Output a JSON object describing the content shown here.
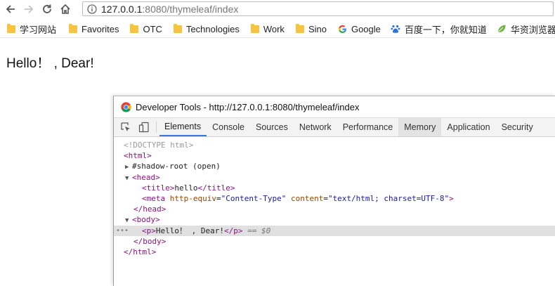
{
  "browser": {
    "url_host": "127.0.0.1",
    "url_path": ":8080/thymeleaf/index",
    "bookmarks": [
      {
        "label": "学习网站",
        "icon": "folder-icon"
      },
      {
        "label": "Favorites",
        "icon": "folder-icon"
      },
      {
        "label": "OTC",
        "icon": "folder-icon"
      },
      {
        "label": "Technologies",
        "icon": "folder-icon"
      },
      {
        "label": "Work",
        "icon": "folder-icon"
      },
      {
        "label": "Sino",
        "icon": "folder-icon"
      },
      {
        "label": "Google",
        "icon": "google-icon"
      },
      {
        "label": "百度一下，你就知道",
        "icon": "baidu-paw-icon"
      },
      {
        "label": "华资浏览器",
        "icon": "leaf-icon"
      }
    ]
  },
  "page": {
    "text": "Hello！ , Dear!"
  },
  "devtools": {
    "title": "Developer Tools - http://127.0.0.1:8080/thymeleaf/index",
    "tabs": [
      "Elements",
      "Console",
      "Sources",
      "Network",
      "Performance",
      "Memory",
      "Application",
      "Security"
    ],
    "selected_tab": "Elements",
    "dom": {
      "doctype": "<!DOCTYPE html>",
      "html_open": "<html>",
      "shadow_root": "#shadow-root (open)",
      "head_open": "<head>",
      "title_open": "<title>",
      "title_text": "hello",
      "title_close": "</title>",
      "meta_open": "<meta ",
      "meta_attr1": "http-equiv",
      "meta_val1": "\"Content-Type\"",
      "meta_attr2": "content",
      "meta_val2": "\"text/html; charset=UTF-8\"",
      "meta_close": ">",
      "head_close": "</head>",
      "body_open": "<body>",
      "p_open": "<p>",
      "p_text": "Hello！ , Dear!",
      "p_close": "</p>",
      "eq0": " == $0",
      "body_close": "</body>",
      "html_close": "</html>",
      "gutter": "•••"
    }
  },
  "colors": {
    "tag": "#881280",
    "attr": "#994500",
    "attr_value": "#1a1aa6",
    "selected_tab_underline": "#3879d9"
  }
}
